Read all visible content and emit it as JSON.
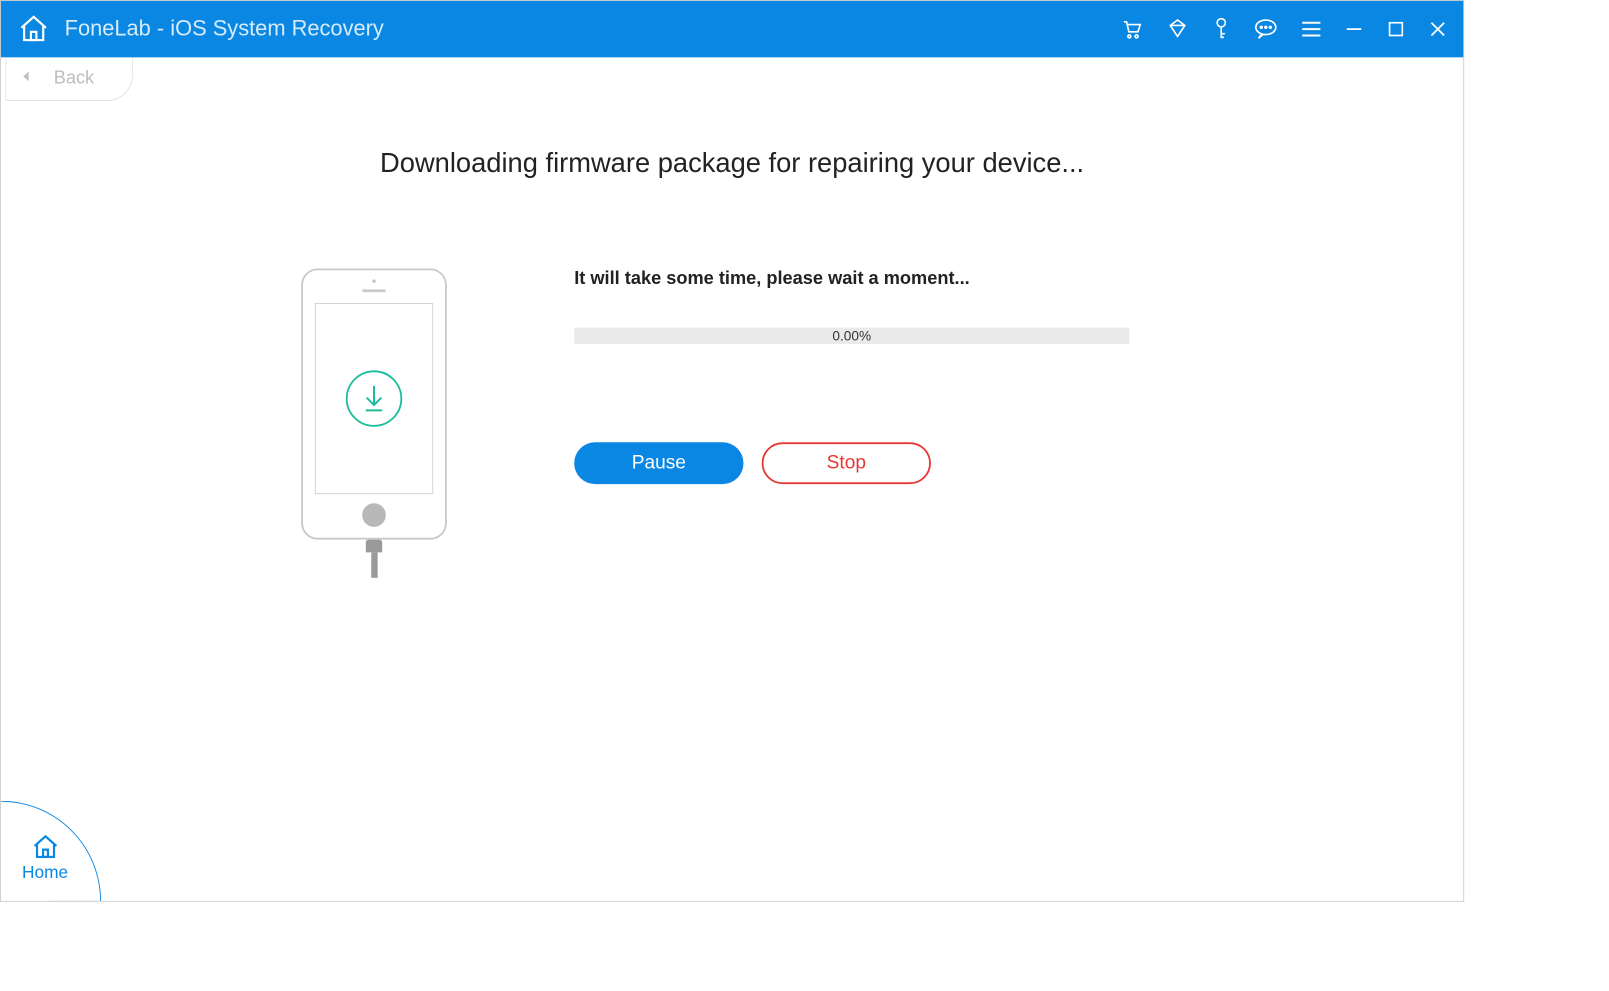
{
  "titlebar": {
    "app_title": "FoneLab - iOS System Recovery"
  },
  "nav": {
    "back_label": "Back"
  },
  "main": {
    "heading": "Downloading firmware package for repairing your device...",
    "wait_text": "It will take some time, please wait a moment...",
    "progress_text": "0.00%",
    "progress_value": 0
  },
  "buttons": {
    "pause_label": "Pause",
    "stop_label": "Stop"
  },
  "footer": {
    "home_label": "Home"
  }
}
